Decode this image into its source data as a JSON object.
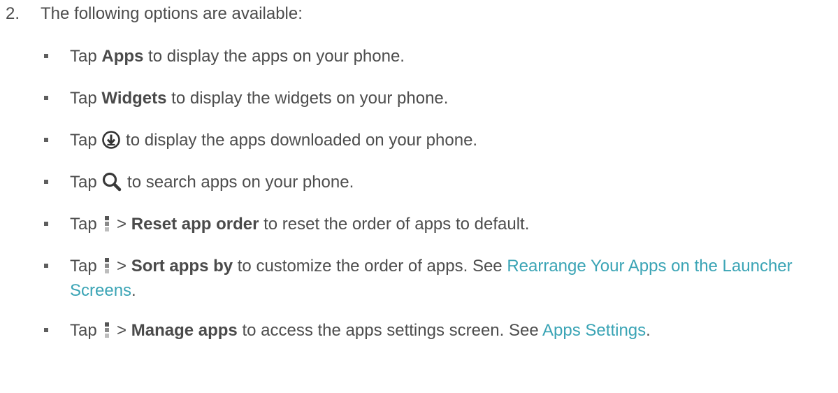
{
  "step": {
    "number": "2.",
    "text": "The following options are available:"
  },
  "options": [
    {
      "lead": "Tap ",
      "bold": "Apps",
      "tail": " to display the apps on your phone."
    },
    {
      "lead": "Tap ",
      "bold": "Widgets",
      "tail": " to display the widgets on your phone."
    },
    {
      "lead": "Tap ",
      "icon": "download-circle-icon",
      "tail": " to display the apps downloaded on your phone."
    },
    {
      "lead": "Tap ",
      "icon": "search-icon",
      "tail": " to search apps on your phone."
    },
    {
      "lead": "Tap ",
      "icon": "menu-icon",
      "sep": " > ",
      "bold": "Reset app order",
      "tail": " to reset the order of apps to default."
    },
    {
      "lead": "Tap ",
      "icon": "menu-icon",
      "sep": " > ",
      "bold": "Sort apps by",
      "tail": " to customize the order of apps. See ",
      "link": "Rearrange Your Apps on the Launcher Screens",
      "end": "."
    },
    {
      "lead": "Tap ",
      "icon": "menu-icon",
      "sep": " > ",
      "bold": "Manage apps",
      "tail": " to access the apps settings screen. See ",
      "link": "Apps Settings",
      "end": "."
    }
  ],
  "colors": {
    "text": "#4d4d4d",
    "link": "#3aa4b5",
    "menu_icon_top": "#555555",
    "menu_icon_mid": "#8a8a8a",
    "menu_icon_bottom": "#bdbdbd"
  }
}
